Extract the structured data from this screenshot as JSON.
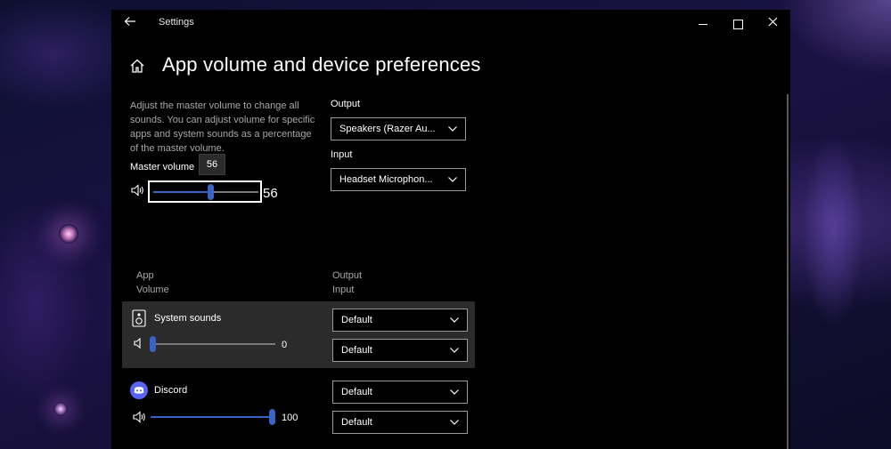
{
  "window": {
    "title": "Settings",
    "back_icon": "back-arrow-icon",
    "controls": [
      "minimize-icon",
      "maximize-icon",
      "close-icon"
    ]
  },
  "page": {
    "title": "App volume and device preferences",
    "description": "Adjust the master volume to change all sounds. You can adjust volume for specific apps and system sounds as a percentage of the master volume."
  },
  "master_volume": {
    "label": "Master volume",
    "value": 56,
    "value_text": "56",
    "tooltip": "56"
  },
  "output": {
    "label": "Output",
    "selected": "Speakers (Razer Au..."
  },
  "input": {
    "label": "Input",
    "selected": "Headset Microphon..."
  },
  "columns": {
    "app_line1": "App",
    "app_line2": "Volume",
    "io_line1": "Output",
    "io_line2": "Input"
  },
  "apps": [
    {
      "name": "System sounds",
      "icon": "speaker-box-icon",
      "volume": 0,
      "volume_text": "0",
      "output": "Default",
      "input": "Default"
    },
    {
      "name": "Discord",
      "icon": "discord-icon",
      "volume": 100,
      "volume_text": "100",
      "output": "Default",
      "input": "Default"
    }
  ],
  "colors": {
    "accent": "#3a63c8",
    "background": "#000000",
    "selected_row": "#2b2b2b"
  }
}
